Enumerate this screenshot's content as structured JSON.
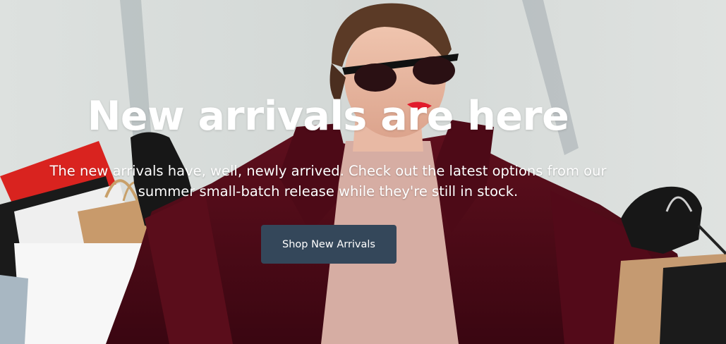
{
  "hero": {
    "title": "New arrivals are here",
    "subtitle": "The new arrivals have, well, newly arrived. Check out the latest options from our summer small-batch release while they're still in stock.",
    "cta_label": "Shop New Arrivals",
    "background_image": "woman-with-shopping-bags-photo",
    "colors": {
      "title": "#ffffff",
      "subtitle": "#ffffff",
      "button_bg": "#34475a",
      "button_text": "#ffffff"
    }
  }
}
